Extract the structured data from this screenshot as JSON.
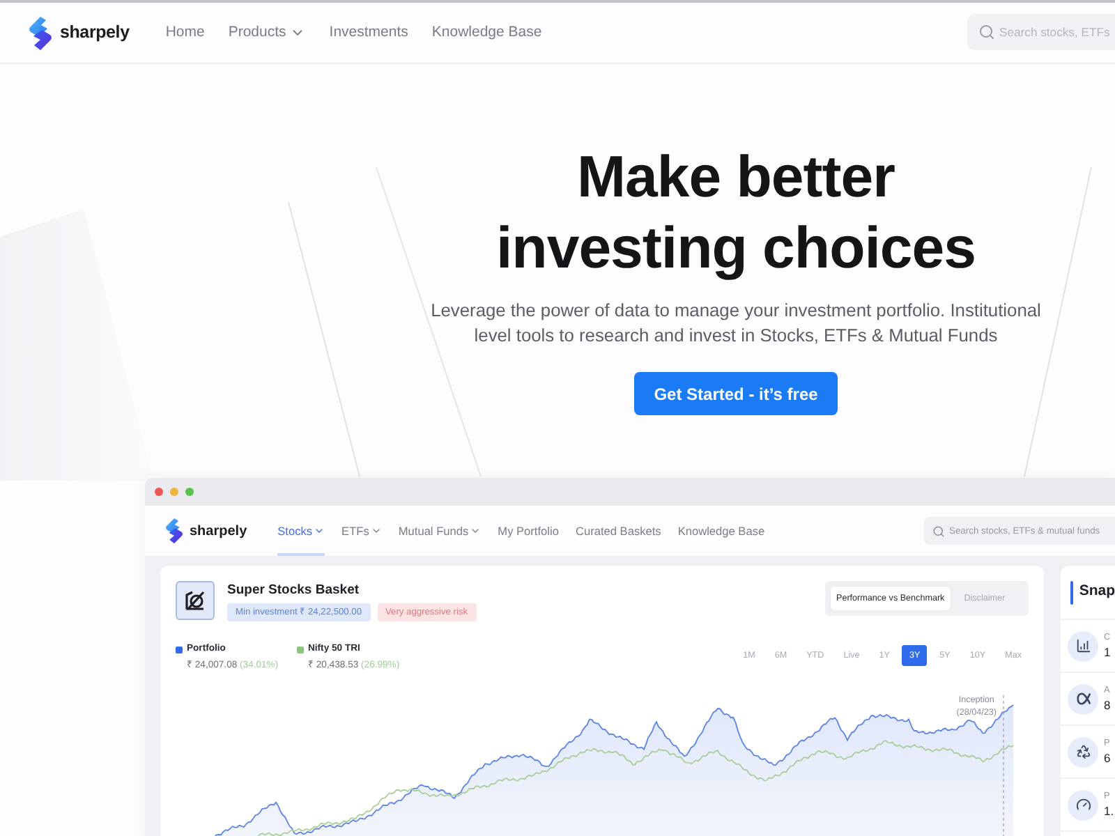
{
  "top_nav": {
    "logo_text": "sharpely",
    "links": [
      {
        "label": "Home",
        "dropdown": false
      },
      {
        "label": "Products",
        "dropdown": true
      },
      {
        "label": "Investments",
        "dropdown": false
      },
      {
        "label": "Knowledge Base",
        "dropdown": false
      }
    ],
    "search": {
      "placeholder": "Search stocks, ETFs"
    }
  },
  "hero": {
    "title_lines": [
      "Make better",
      "investing choices"
    ],
    "subtitle_lines": [
      "Leverage the power of data to manage your investment portfolio. Institutional",
      "level tools to research and invest in Stocks, ETFs & Mutual Funds"
    ],
    "cta": {
      "label": "Get Started - it’s free"
    }
  },
  "app_window": {
    "nav": {
      "logo_text": "sharpely",
      "links": [
        {
          "label": "Stocks",
          "dropdown": true,
          "selected": true
        },
        {
          "label": "ETFs",
          "dropdown": true,
          "selected": false
        },
        {
          "label": "Mutual Funds",
          "dropdown": true,
          "selected": false
        },
        {
          "label": "My Portfolio",
          "dropdown": false,
          "selected": false
        },
        {
          "label": "Curated Baskets",
          "dropdown": false,
          "selected": false
        },
        {
          "label": "Knowledge Base",
          "dropdown": false,
          "selected": false
        }
      ],
      "search": {
        "placeholder": "Search stocks, ETFs & mutual funds"
      }
    },
    "basket_card": {
      "title": "Super Stocks Basket",
      "badges": [
        {
          "label": "Min investment ₹ 24,22,500.00",
          "kind": "info"
        },
        {
          "label": "Very aggressive risk",
          "kind": "risk"
        }
      ],
      "tabs": [
        {
          "label": "Performance vs Benchmark",
          "selected": true
        },
        {
          "label": "Disclaimer",
          "selected": false
        }
      ],
      "legend": [
        {
          "name": "Portfolio",
          "color": "#2f6bea",
          "value": "₹ 24,007.08",
          "change": "(34.01%)"
        },
        {
          "name": "Nifty 50 TRI",
          "color": "#8cc47e",
          "value": "₹ 20,438.53",
          "change": "(26.99%)"
        }
      ],
      "ranges": [
        {
          "label": "1M",
          "selected": false
        },
        {
          "label": "6M",
          "selected": false
        },
        {
          "label": "YTD",
          "selected": false
        },
        {
          "label": "Live",
          "selected": false
        },
        {
          "label": "1Y",
          "selected": false
        },
        {
          "label": "3Y",
          "selected": true
        },
        {
          "label": "5Y",
          "selected": false
        },
        {
          "label": "10Y",
          "selected": false
        },
        {
          "label": "Max",
          "selected": false
        }
      ],
      "inception_lines": [
        "Inception",
        "(28/04/23)"
      ]
    },
    "snapshot_panel": {
      "title": "Snap",
      "rows": [
        {
          "kind": "chart",
          "label": "C",
          "value": "1"
        },
        {
          "kind": "alpha",
          "label": "A",
          "value": "8"
        },
        {
          "kind": "recycle",
          "label": "P",
          "value": "6"
        },
        {
          "kind": "gauge",
          "label": "P",
          "value": "1."
        }
      ]
    }
  }
}
